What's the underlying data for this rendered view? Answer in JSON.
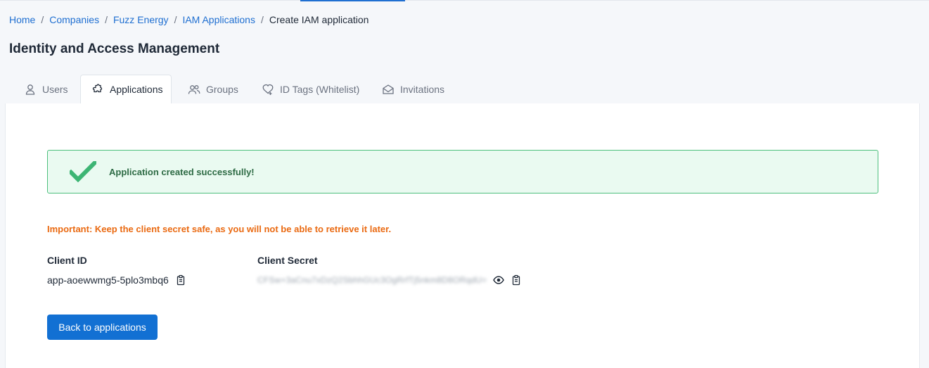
{
  "breadcrumb": {
    "items": [
      "Home",
      "Companies",
      "Fuzz Energy",
      "IAM Applications"
    ],
    "current": "Create IAM application",
    "separator": "/"
  },
  "page": {
    "title": "Identity and Access Management"
  },
  "tabs": [
    {
      "label": "Users",
      "icon": "user-icon",
      "active": false
    },
    {
      "label": "Applications",
      "icon": "puzzle-icon",
      "active": true
    },
    {
      "label": "Groups",
      "icon": "users-icon",
      "active": false
    },
    {
      "label": "ID Tags (Whitelist)",
      "icon": "tag-icon",
      "active": false
    },
    {
      "label": "Invitations",
      "icon": "envelope-icon",
      "active": false
    }
  ],
  "alert": {
    "message": "Application created successfully!",
    "icon": "check-icon",
    "color": "#4cbf7c"
  },
  "warning": {
    "text": "Important: Keep the client secret safe, as you will not be able to retrieve it later.",
    "color": "#ea6a12"
  },
  "client_id": {
    "label": "Client ID",
    "value": "app-aoewwmg5-5plo3mbq6",
    "copy_icon": "clipboard-icon"
  },
  "client_secret": {
    "label": "Client Secret",
    "value": "CFSw+3aCnu7xDzQ2SbhhGUc3OgRrfTj5nkm8D8ORqdU=",
    "reveal_icon": "eye-icon",
    "copy_icon": "clipboard-icon"
  },
  "actions": {
    "back_label": "Back to applications"
  },
  "colors": {
    "accent": "#1f6fd1",
    "button": "#1270d3"
  }
}
